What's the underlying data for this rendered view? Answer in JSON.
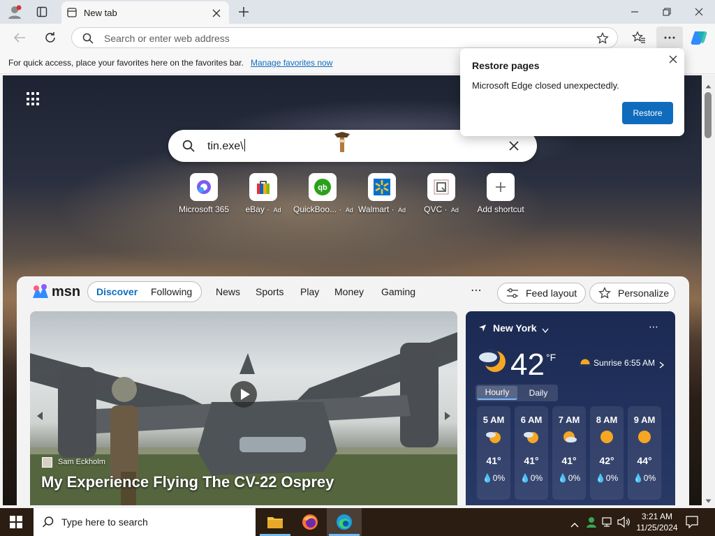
{
  "browser": {
    "tab_title": "New tab",
    "address_placeholder": "Search or enter web address",
    "favorites_message": "For quick access, place your favorites here on the favorites bar.",
    "favorites_link": "Manage favorites now"
  },
  "restore_popup": {
    "title": "Restore pages",
    "message": "Microsoft Edge closed unexpectedly.",
    "button": "Restore"
  },
  "newtab": {
    "search_value": "tin.exe\\",
    "shortcuts": [
      {
        "label": "Microsoft 365",
        "ad": ""
      },
      {
        "label": "eBay",
        "ad": "Ad"
      },
      {
        "label": "QuickBoo...",
        "ad": "Ad"
      },
      {
        "label": "Walmart",
        "ad": "Ad"
      },
      {
        "label": "QVC",
        "ad": "Ad"
      },
      {
        "label": "Add shortcut",
        "ad": ""
      }
    ]
  },
  "msn": {
    "logo": "msn",
    "tabs": [
      "Discover",
      "Following"
    ],
    "nav": [
      "News",
      "Sports",
      "Play",
      "Money",
      "Gaming"
    ],
    "feed_layout": "Feed layout",
    "personalize": "Personalize",
    "article": {
      "author": "Sam Eckholm",
      "headline": "My Experience Flying The CV-22 Osprey"
    },
    "weather": {
      "location": "New York",
      "temp": "42",
      "unit": "°F",
      "sunrise": "Sunrise 6:55 AM",
      "tab_hourly": "Hourly",
      "tab_daily": "Daily",
      "hours": [
        {
          "time": "5 AM",
          "temp": "41°",
          "precip": "0%"
        },
        {
          "time": "6 AM",
          "temp": "41°",
          "precip": "0%"
        },
        {
          "time": "7 AM",
          "temp": "41°",
          "precip": "0%"
        },
        {
          "time": "8 AM",
          "temp": "42°",
          "precip": "0%"
        },
        {
          "time": "9 AM",
          "temp": "44°",
          "precip": "0%"
        }
      ]
    }
  },
  "taskbar": {
    "search_placeholder": "Type here to search",
    "time": "3:21 AM",
    "date": "11/25/2024"
  },
  "colors": {
    "accent": "#0f6cbd",
    "msn_discover": "#0f6cbd"
  }
}
